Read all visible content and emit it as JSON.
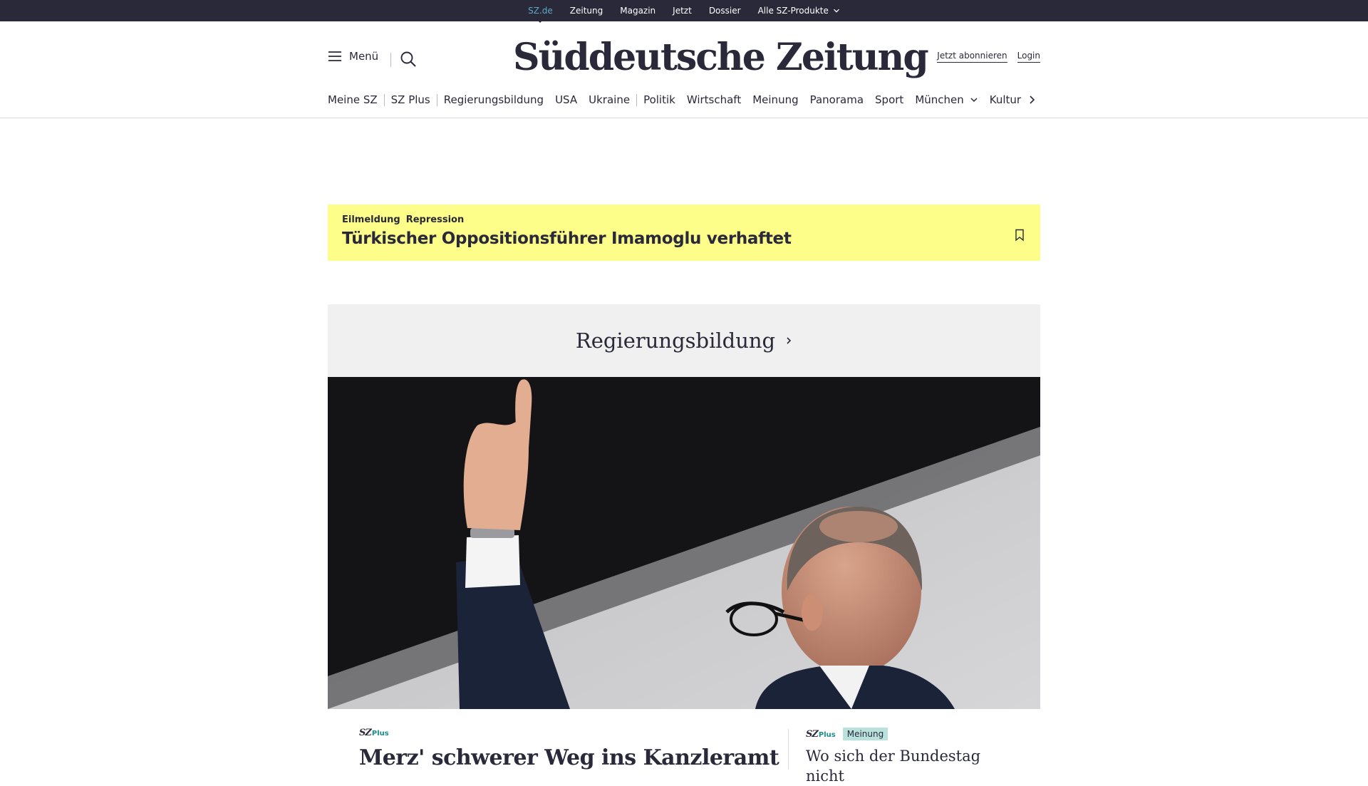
{
  "topbar": {
    "links": [
      "SZ.de",
      "Zeitung",
      "Magazin",
      "Jetzt",
      "Dossier"
    ],
    "products_label": "Alle SZ-Produkte",
    "active_color": "#5fa8c4",
    "background": "#29293a"
  },
  "header": {
    "menu_label": "Menü",
    "logo": "Süddeutsche Zeitung",
    "subscribe_label": "Jetzt abonnieren",
    "login_label": "Login"
  },
  "nav": {
    "items": [
      "Meine SZ",
      "SZ Plus",
      "Regierungsbildung",
      "USA",
      "Ukraine",
      "Politik",
      "Wirtschaft",
      "Meinung",
      "Panorama",
      "Sport",
      "München",
      "Kultur"
    ]
  },
  "breaking": {
    "label": "Eilmeldung",
    "topic": "Repression",
    "headline": "Türkischer Oppositionsführer Imamoglu verhaftet",
    "background": "#fdfd89"
  },
  "section": {
    "title": "Regierungsbildung"
  },
  "teaser_main": {
    "brand": "SZ",
    "plus": "Plus",
    "title": "Merz' schwerer Weg ins Kanzleramt"
  },
  "teaser_side": {
    "brand": "SZ",
    "plus": "Plus",
    "badge": "Meinung",
    "title": "Wo sich der Bundestag nicht"
  },
  "icons": {
    "menu": "hamburger-icon",
    "search": "search-icon",
    "bookmark": "bookmark-icon",
    "nav_next": "chevron-right-icon"
  }
}
